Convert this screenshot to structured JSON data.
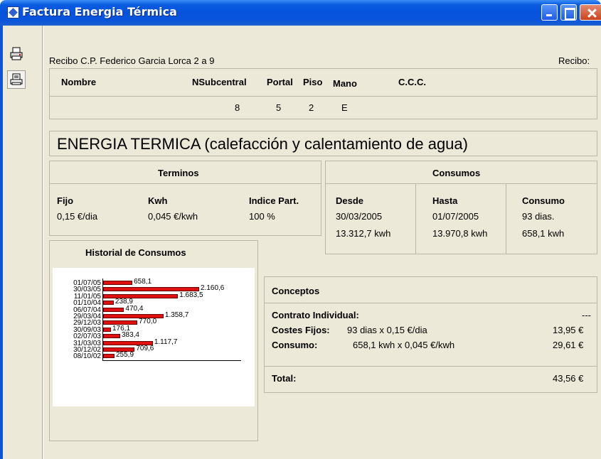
{
  "window": {
    "title": "Factura Energia Térmica"
  },
  "toolbar": {
    "buttons": [
      {
        "icon": "printer-icon",
        "name": "print-button"
      },
      {
        "icon": "document-print-icon",
        "name": "print-preview-button"
      }
    ]
  },
  "header": {
    "recibo_text": "Recibo C.P. Federico Garcia Lorca 2 a 9",
    "recibo_label": "Recibo:"
  },
  "info_table": {
    "columns": [
      "Nombre",
      "NSubcentral",
      "Portal",
      "Piso",
      "Mano",
      "C.C.C."
    ],
    "row": {
      "nombre": "",
      "nsubcentral": "8",
      "portal": "5",
      "piso": "2",
      "mano": "E",
      "ccc": ""
    }
  },
  "energy_title": "ENERGIA TERMICA (calefacción y calentamiento de agua)",
  "terminos": {
    "title": "Terminos",
    "headers": [
      "Fijo",
      "Kwh",
      "Indice Part."
    ],
    "values": [
      "0,15 €/dia",
      "0,045 €/kwh",
      "100 %"
    ]
  },
  "consumos": {
    "title": "Consumos",
    "headers": [
      "Desde",
      "Hasta",
      "Consumo"
    ],
    "row1": [
      "30/03/2005",
      "01/07/2005",
      "93 dias."
    ],
    "row2": [
      "13.312,7 kwh",
      "13.970,8 kwh",
      "658,1 kwh"
    ]
  },
  "historial": {
    "title": "Historial de Consumos"
  },
  "chart_data": {
    "type": "bar",
    "orientation": "horizontal",
    "categories": [
      "01/07/05",
      "30/03/05",
      "11/01/05",
      "01/10/04",
      "06/07/04",
      "29/03/04",
      "29/12/03",
      "30/09/03",
      "02/07/03",
      "31/03/03",
      "30/12/02",
      "08/10/02"
    ],
    "values": [
      658.1,
      2160.6,
      1683.5,
      238.9,
      470.4,
      1358.7,
      770.0,
      176.1,
      383.4,
      1117.7,
      709.6,
      255.9
    ],
    "value_labels": [
      "658,1",
      "2.160,6",
      "1.683,5",
      "238,9",
      "470,4",
      "1.358,7",
      "770,0",
      "176,1",
      "383,4",
      "1.117,7",
      "709,6",
      "255,9"
    ],
    "bar_color": "#e01010"
  },
  "conceptos": {
    "title": "Conceptos",
    "contrato_label": "Contrato Individual:",
    "contrato_value": "---",
    "costes_label": "Costes Fijos:",
    "costes_detail": "93 dias x 0,15 €/dia",
    "costes_value": "13,95 €",
    "consumo_label": "Consumo:",
    "consumo_detail": "658,1 kwh x 0,045 €/kwh",
    "consumo_value": "29,61 €",
    "total_label": "Total:",
    "total_value": "43,56 €"
  }
}
